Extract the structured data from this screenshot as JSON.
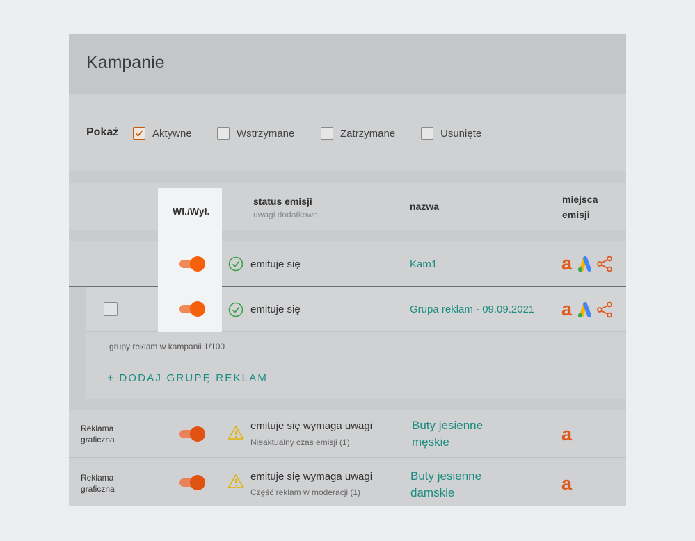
{
  "header": {
    "title": "Kampanie"
  },
  "filters": {
    "label": "Pokaż",
    "options": [
      {
        "label": "Aktywne",
        "checked": true
      },
      {
        "label": "Wstrzymane",
        "checked": false
      },
      {
        "label": "Zatrzymane",
        "checked": false
      },
      {
        "label": "Usunięte",
        "checked": false
      }
    ]
  },
  "table": {
    "columns": {
      "toggle": "Wł./Wył.",
      "status": "status emisji",
      "status_sub": "uwagi dodatkowe",
      "name": "nazwa",
      "channels_line1": "miejsca",
      "channels_line2": "emisji"
    },
    "campaign": {
      "on": true,
      "status": "emituje się",
      "name": "Kam1",
      "channels": [
        "allegro-icon",
        "google-ads-icon",
        "share-icon"
      ]
    },
    "ad_group": {
      "on": true,
      "status": "emituje się",
      "name": "Grupa reklam - 09.09.2021",
      "channels": [
        "allegro-icon",
        "google-ads-icon",
        "share-icon"
      ]
    },
    "group_footer": {
      "count_text": "grupy reklam w kampanii 1/100",
      "add_label": "+ DODAJ GRUPĘ REKLAM"
    },
    "rows": [
      {
        "type_line1": "Reklama",
        "type_line2": "graficzna",
        "on": true,
        "status": "emituje się wymaga uwagi",
        "status_note": "Nieaktualny czas emisji (1)",
        "name_line1": "Buty jesienne",
        "name_line2": "męskie",
        "channels": [
          "allegro-icon"
        ]
      },
      {
        "type_line1": "Reklama",
        "type_line2": "graficzna",
        "on": true,
        "status": "emituje się wymaga uwagi",
        "status_note": "Część reklam w moderacji (1)",
        "name_line1": "Buty jesienne",
        "name_line2": "damskie",
        "channels": [
          "allegro-icon"
        ]
      }
    ]
  },
  "colors": {
    "accent_orange": "#f4600c",
    "link_teal": "#1c8c80",
    "ok_green": "#3aa14c",
    "warn_yellow": "#e0b400"
  }
}
